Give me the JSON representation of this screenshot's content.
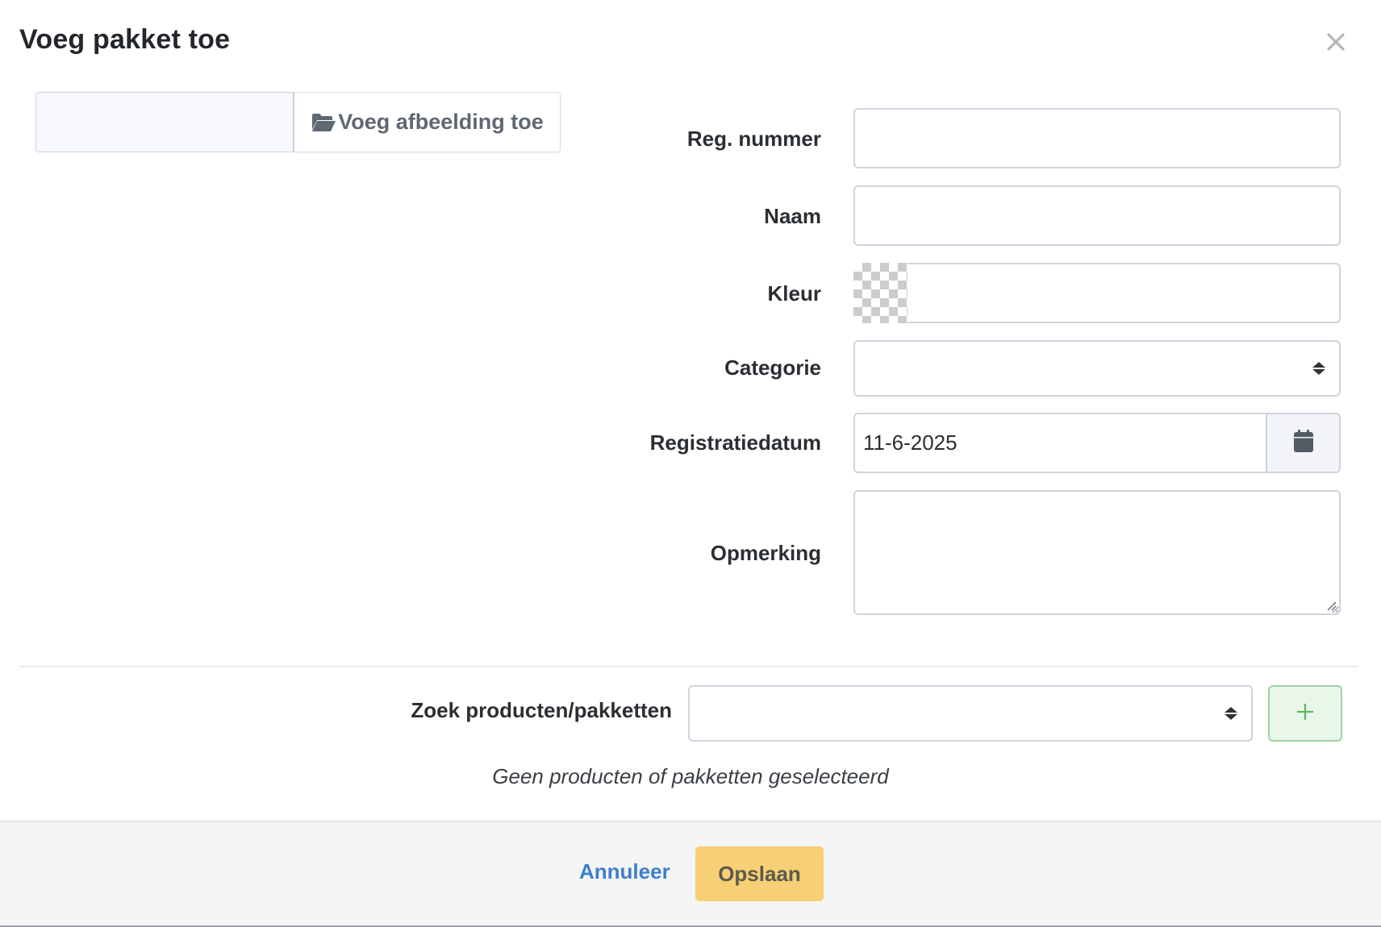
{
  "modal": {
    "title": "Voeg pakket toe"
  },
  "upload": {
    "button_label": "Voeg afbeelding toe",
    "icon": "folder-open-icon"
  },
  "form": {
    "reg_number": {
      "label": "Reg. nummer",
      "value": ""
    },
    "name": {
      "label": "Naam",
      "value": ""
    },
    "color": {
      "label": "Kleur",
      "value": ""
    },
    "category": {
      "label": "Categorie",
      "value": ""
    },
    "registration_date": {
      "label": "Registratiedatum",
      "value": "11-6-2025",
      "icon": "calendar-icon"
    },
    "remark": {
      "label": "Opmerking",
      "value": ""
    }
  },
  "products": {
    "search_label": "Zoek producten/pakketten",
    "search_value": "",
    "add_icon": "plus-icon",
    "empty_message": "Geen producten of pakketten geselecteerd"
  },
  "footer": {
    "cancel_label": "Annuleer",
    "save_label": "Opslaan"
  },
  "colors": {
    "accent_link": "#3d7fd0",
    "save_button": "#f7cf74",
    "add_button_bg": "#e9f7ea",
    "add_button_icon": "#5cb85c"
  }
}
